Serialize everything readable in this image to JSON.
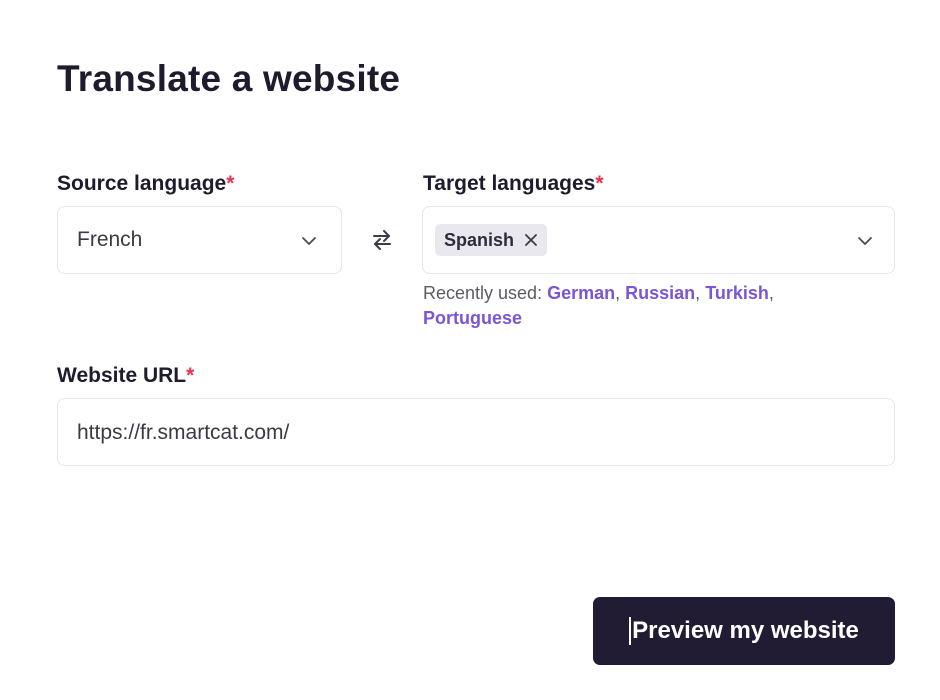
{
  "page": {
    "title": "Translate a website"
  },
  "form": {
    "required_mark": "*",
    "source": {
      "label": "Source language",
      "value": "French",
      "chevron_icon": "chevron-down-icon"
    },
    "swap_icon": "swap-arrows-icon",
    "target": {
      "label": "Target languages",
      "selected": [
        {
          "label": "Spanish",
          "remove_icon": "close-icon"
        }
      ],
      "chevron_icon": "chevron-down-icon"
    },
    "recently_used": {
      "prefix": "Recently used:",
      "languages": [
        "German",
        "Russian",
        "Turkish",
        "Portuguese"
      ]
    },
    "url": {
      "label": "Website URL",
      "value": "https://fr.smartcat.com/"
    }
  },
  "actions": {
    "preview_label": "Preview my website"
  },
  "colors": {
    "text": "#1e1b2e",
    "required": "#e5334a",
    "link": "#7a55d6",
    "button_bg": "#211c33",
    "chip_bg": "#e9e8ee",
    "border": "#e6e6ec"
  }
}
